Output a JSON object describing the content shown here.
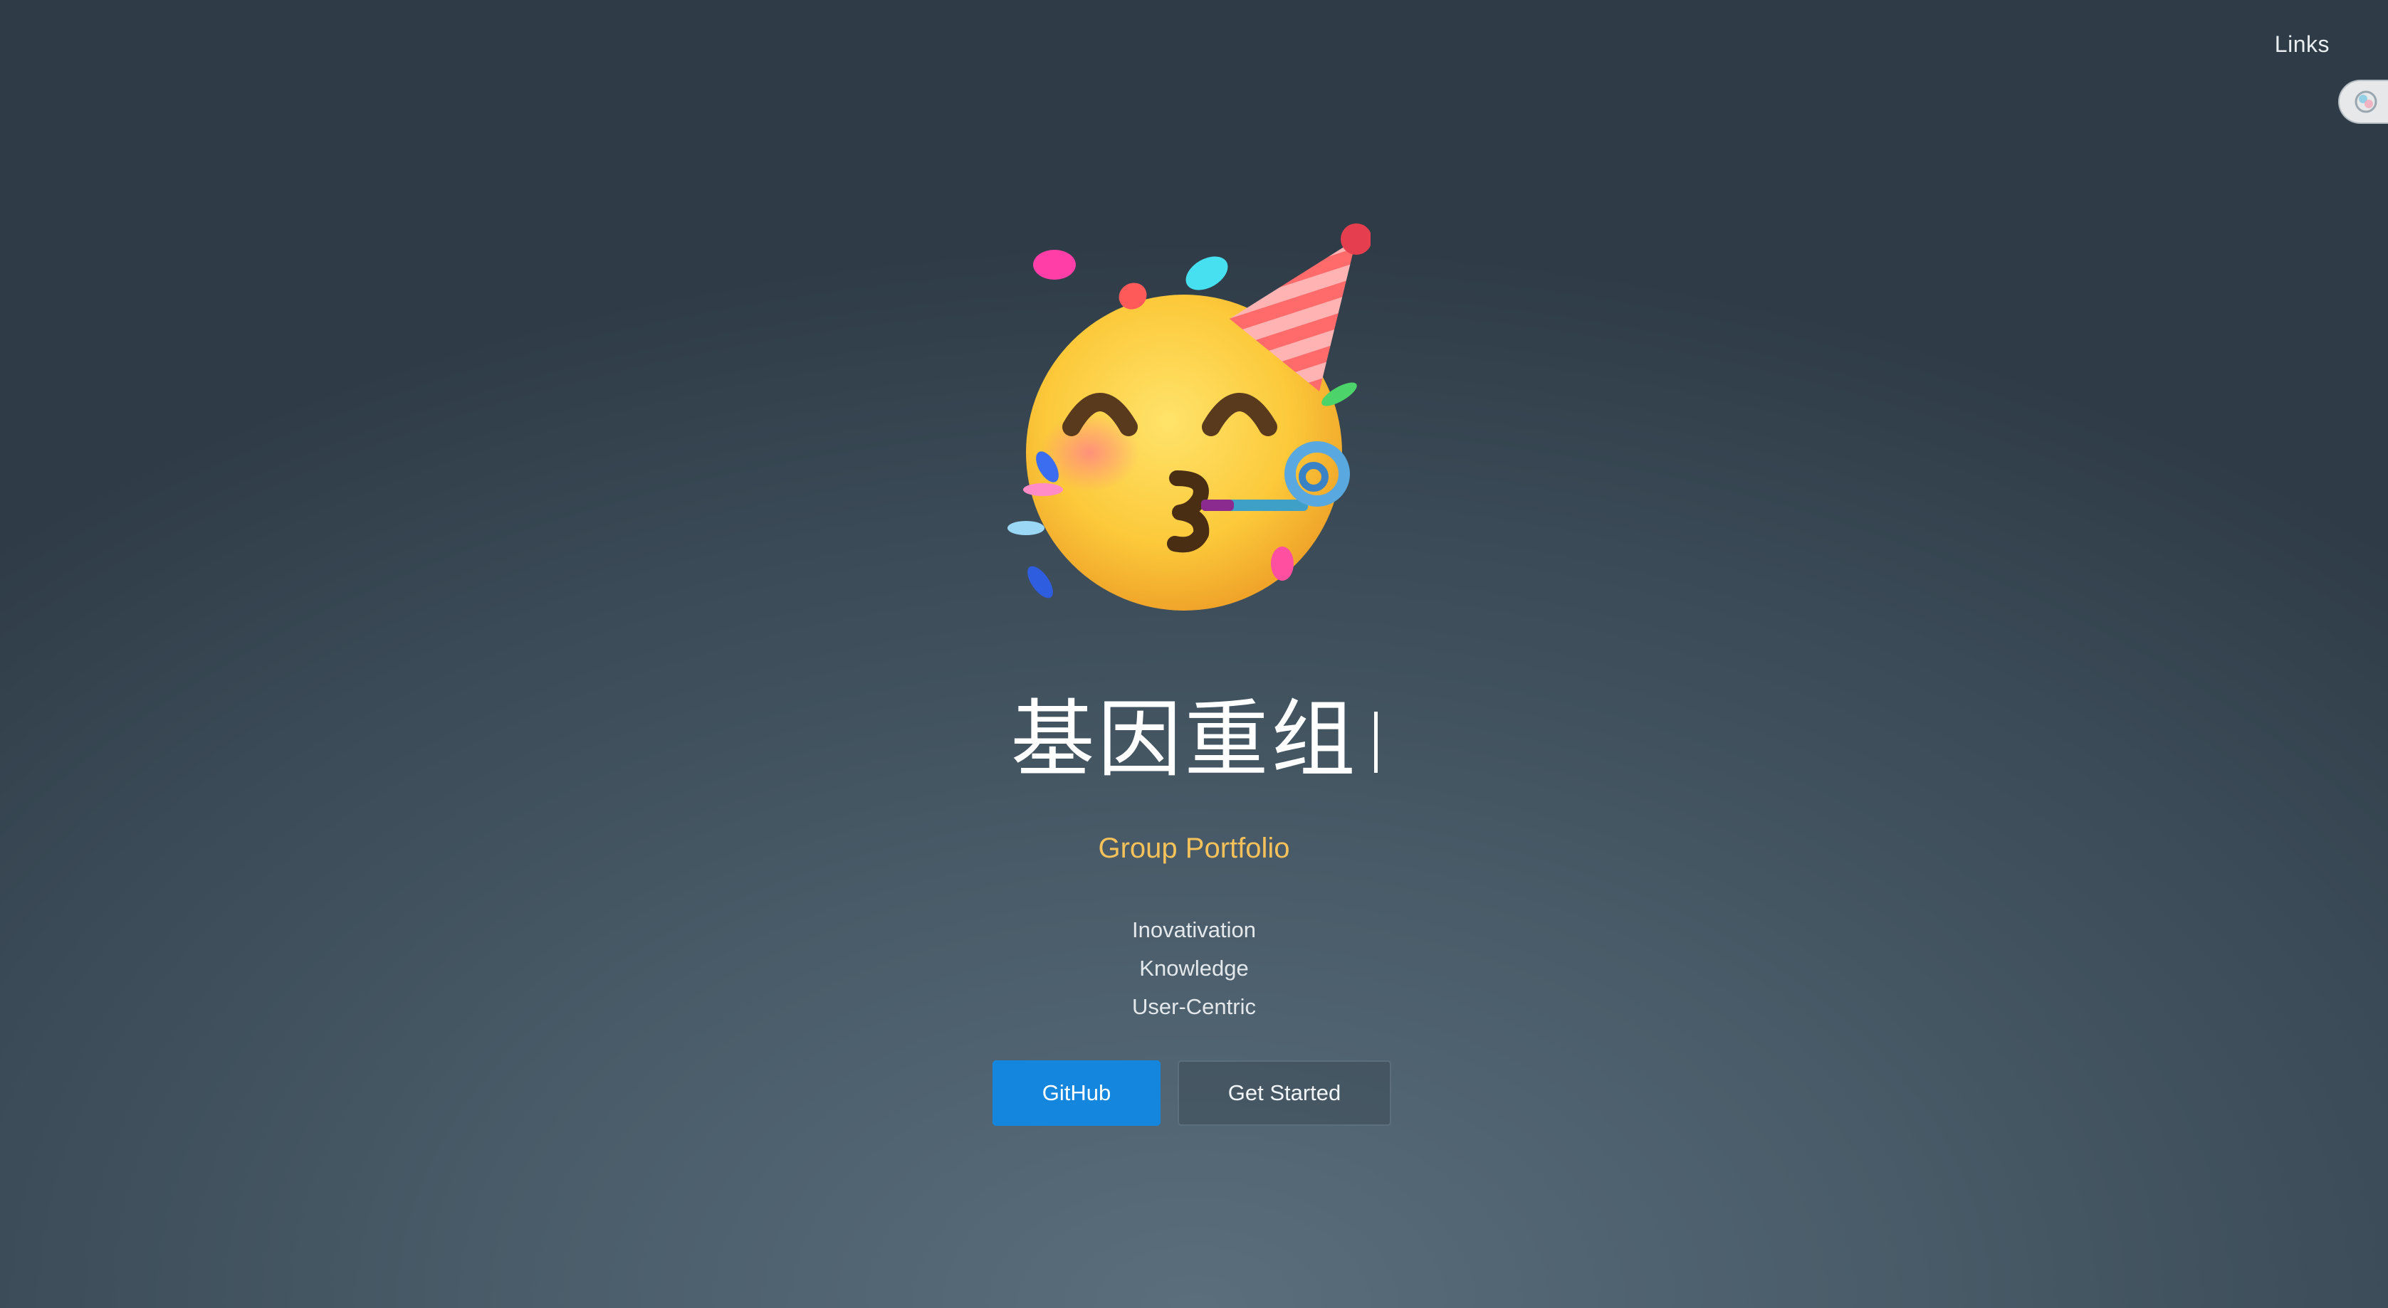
{
  "nav": {
    "links_label": "Links"
  },
  "hero": {
    "image_icon": "partying-face-icon",
    "title": "基因重组",
    "tagline": "Group Portfolio",
    "values": [
      "Inovativation",
      "Knowledge",
      "User-Centric"
    ]
  },
  "actions": {
    "primary_label": "GitHub",
    "secondary_label": "Get Started"
  },
  "colors": {
    "accent_primary": "#1486dd",
    "tagline": "#f5c15a"
  }
}
